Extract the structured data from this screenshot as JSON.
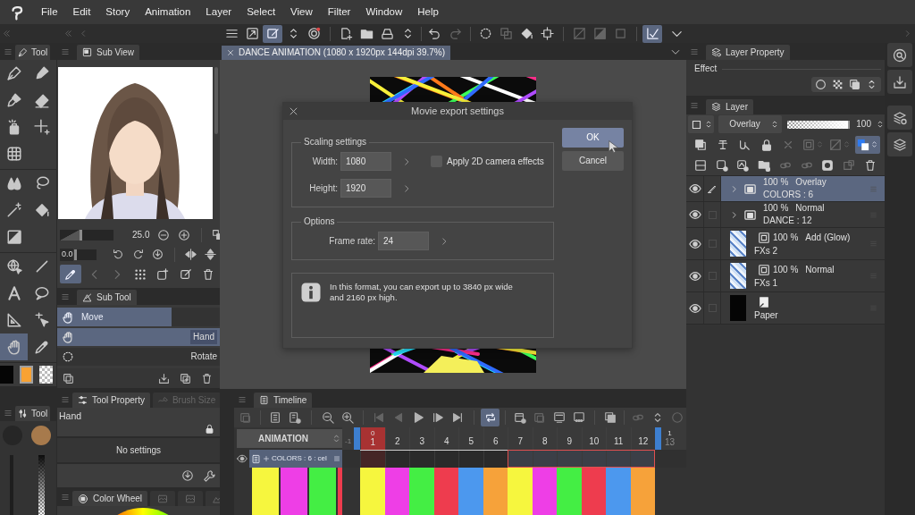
{
  "menu_bar": {
    "items": [
      "File",
      "Edit",
      "Story",
      "Animation",
      "Layer",
      "Select",
      "View",
      "Filter",
      "Window",
      "Help"
    ]
  },
  "command_bar": {
    "buttons": [
      {
        "selected": false,
        "disabled": false
      },
      {
        "selected": false,
        "disabled": false
      },
      {
        "selected": true,
        "disabled": false
      },
      {
        "selected": false,
        "disabled": false
      },
      {
        "selected": false,
        "disabled": false
      },
      {
        "selected": false,
        "disabled": false
      },
      {
        "selected": false,
        "disabled": false
      },
      {
        "selected": false,
        "disabled": false
      },
      {
        "selected": false,
        "disabled": false
      },
      {
        "selected": false,
        "disabled": false
      },
      {
        "selected": false,
        "disabled": true
      },
      {
        "selected": false,
        "disabled": false
      },
      {
        "selected": false,
        "disabled": true
      },
      {
        "selected": false,
        "disabled": false
      },
      {
        "selected": false,
        "disabled": false
      },
      {
        "selected": false,
        "disabled": true
      },
      {
        "selected": false,
        "disabled": true
      },
      {
        "selected": false,
        "disabled": true
      },
      {
        "selected": true,
        "disabled": false
      },
      {
        "selected": false,
        "disabled": false
      }
    ]
  },
  "tool_panel": {
    "tab": "Tool",
    "groups": [
      {
        "tools": [
          {
            "selected": false
          },
          {
            "selected": false
          },
          {
            "selected": false
          },
          {
            "selected": false
          },
          {
            "selected": false
          },
          {
            "selected": false
          },
          {
            "selected": false
          }
        ]
      },
      {
        "tools": [
          {
            "selected": false
          },
          {
            "selected": false
          },
          {
            "selected": false
          },
          {
            "selected": false
          },
          {
            "selected": false
          }
        ]
      },
      {
        "tools": [
          {
            "selected": false
          },
          {
            "selected": false
          },
          {
            "selected": false
          },
          {
            "selected": false
          },
          {
            "selected": false
          },
          {
            "selected": false
          },
          {
            "selected": true
          },
          {
            "selected": false
          }
        ]
      }
    ],
    "colors": [
      {
        "kind": "solid",
        "color": "#050505",
        "selected": false
      },
      {
        "kind": "solid",
        "color": "#f8a233",
        "selected": true
      },
      {
        "kind": "transparent",
        "selected": false
      }
    ]
  },
  "sub_view": {
    "tab": "Sub View",
    "zoom_slider": {
      "level": 0.42
    },
    "zoom": "25.0",
    "rotation": "0.0",
    "rotation_slider": {
      "level": 0.1
    },
    "tools": [
      {
        "selected": true,
        "disabled": false
      },
      {
        "selected": false,
        "disabled": true
      },
      {
        "selected": false,
        "disabled": true
      },
      {
        "selected": false,
        "disabled": false
      },
      {
        "selected": false,
        "disabled": false
      },
      {
        "selected": false,
        "disabled": false
      },
      {
        "selected": false,
        "disabled": false
      }
    ]
  },
  "sub_tool": {
    "tab": "Sub Tool",
    "group": "Move",
    "items": [
      {
        "label": "Hand",
        "selected": true
      },
      {
        "label": "Rotate",
        "selected": false
      }
    ]
  },
  "tool_property": {
    "tabs": [
      {
        "label": "Tool Property",
        "selected": true
      },
      {
        "label": "Brush Size",
        "selected": false
      }
    ],
    "tool_name": "Hand",
    "message": "No settings"
  },
  "color_panel": {
    "tabs": [
      {
        "label": "Color Wheel",
        "selected": true
      },
      {
        "selected": false
      },
      {
        "selected": false
      },
      {
        "selected": false
      }
    ]
  },
  "mini_tool": {
    "tab": "Tool",
    "colors": [
      {
        "color": "#262626"
      },
      {
        "color": "#a77a4c"
      }
    ]
  },
  "canvas": {
    "tab": "DANCE ANIMATION (1080 x 1920px 144dpi 39.7%)"
  },
  "dialog": {
    "title": "Movie export settings",
    "scaling": {
      "title": "Scaling settings",
      "fields": [
        {
          "label": "Width:",
          "value": "1080"
        },
        {
          "label": "Height:",
          "value": "1920"
        }
      ],
      "camera_effects": {
        "label": "Apply 2D camera effects",
        "checked": false
      }
    },
    "options": {
      "title": "Options",
      "fields": [
        {
          "label": "Frame rate:",
          "value": "24"
        }
      ]
    },
    "note": "In this format, you can export up to 3840 px wide and 2160 px high.",
    "buttons": [
      {
        "label": "OK",
        "highlighted": true
      },
      {
        "label": "Cancel",
        "highlighted": false
      }
    ]
  },
  "layer_property": {
    "tab": "Layer Property",
    "section": "Effect"
  },
  "layer_panel": {
    "tab": "Layer",
    "blend_mode": "Overlay",
    "opacity_slider": {
      "level": 1
    },
    "opacity": "100",
    "tool_rows": [
      {
        "buttons": [
          {
            "selected": false,
            "disabled": false
          },
          {
            "selected": false,
            "disabled": false
          },
          {
            "selected": false,
            "disabled": false
          },
          {
            "selected": false,
            "disabled": false
          },
          {
            "selected": false,
            "disabled": true
          },
          {
            "selected": false,
            "disabled": true
          },
          {
            "selected": false,
            "disabled": true
          },
          {
            "selected": true,
            "disabled": false
          }
        ]
      },
      {
        "buttons": [
          {
            "selected": false,
            "disabled": false
          },
          {
            "selected": false,
            "disabled": false
          },
          {
            "selected": false,
            "disabled": false
          },
          {
            "selected": false,
            "disabled": false
          },
          {
            "selected": false,
            "disabled": true
          },
          {
            "selected": false,
            "disabled": true
          },
          {
            "selected": false,
            "disabled": false
          },
          {
            "selected": false,
            "disabled": true
          },
          {
            "selected": false,
            "disabled": false
          }
        ]
      }
    ],
    "layers": [
      {
        "kind": "folder",
        "visible": true,
        "editing": true,
        "expanded": false,
        "opacity": "100 %",
        "blend": "Overlay",
        "name": "COLORS : 6",
        "selected": true
      },
      {
        "kind": "folder",
        "visible": true,
        "editing": false,
        "expanded": false,
        "opacity": "100 %",
        "blend": "Normal",
        "name": "DANCE : 12",
        "selected": false
      },
      {
        "kind": "raster",
        "visible": true,
        "editing": false,
        "opacity": "100 %",
        "blend": "Add (Glow)",
        "name": "FXs 2",
        "selected": false
      },
      {
        "kind": "raster",
        "visible": true,
        "editing": false,
        "opacity": "100 %",
        "blend": "Normal",
        "name": "FXs 1",
        "selected": false
      },
      {
        "kind": "paper",
        "visible": true,
        "editing": false,
        "name": "Paper",
        "selected": false
      }
    ]
  },
  "timeline": {
    "tab": "Timeline",
    "tools": [
      {
        "selected": false,
        "disabled": true
      },
      {
        "selected": false,
        "disabled": false
      },
      {
        "selected": false,
        "disabled": false
      },
      {
        "selected": false,
        "disabled": false
      },
      {
        "selected": false,
        "disabled": false
      },
      {
        "selected": false,
        "disabled": true
      },
      {
        "selected": false,
        "disabled": true
      },
      {
        "selected": false,
        "disabled": false
      },
      {
        "selected": false,
        "disabled": false
      },
      {
        "selected": false,
        "disabled": false
      },
      {
        "selected": true,
        "disabled": false
      },
      {
        "selected": false,
        "disabled": false
      },
      {
        "selected": false,
        "disabled": true
      },
      {
        "selected": false,
        "disabled": false
      },
      {
        "selected": false,
        "disabled": false
      },
      {
        "selected": false,
        "disabled": false
      },
      {
        "selected": false,
        "disabled": true
      },
      {
        "selected": false,
        "disabled": false
      },
      {
        "selected": false,
        "disabled": true
      }
    ],
    "track_selector": "ANIMATION",
    "ruler": {
      "before": "-1",
      "frames": [
        {
          "label": "1",
          "mark": "0",
          "selected": true
        },
        {
          "label": "2",
          "selected": false
        },
        {
          "label": "3",
          "selected": false
        },
        {
          "label": "4",
          "selected": false
        },
        {
          "label": "5",
          "selected": false
        },
        {
          "label": "6",
          "selected": false
        },
        {
          "label": "7",
          "selected": false
        },
        {
          "label": "8",
          "selected": false
        },
        {
          "label": "9",
          "selected": false
        },
        {
          "label": "10",
          "selected": false
        },
        {
          "label": "11",
          "selected": false
        },
        {
          "label": "12",
          "selected": false
        }
      ],
      "after": {
        "label": "13",
        "mark": "1"
      }
    },
    "track": {
      "name": "COLORS : 6 : cel",
      "visible": true,
      "cels": [
        {
          "selected": false
        },
        {
          "selected": true
        }
      ],
      "thumbnails": [
        {
          "color": "#f6f63e"
        },
        {
          "color": "#ee3ee6"
        },
        {
          "color": "#44ee44"
        },
        {
          "color": "#ee3c4e"
        }
      ],
      "frames": [
        {
          "color": "#f6f63e"
        },
        {
          "color": "#ee3ee6"
        },
        {
          "color": "#44ee44"
        },
        {
          "color": "#ee3c4e"
        },
        {
          "color": "#4c98ee"
        },
        {
          "color": "#f6a23a"
        },
        {
          "color": "#f6f63e"
        },
        {
          "color": "#ee3ee6"
        },
        {
          "color": "#44ee44"
        },
        {
          "color": "#ee3c4e"
        },
        {
          "color": "#4c98ee"
        },
        {
          "color": "#f6a23a"
        }
      ]
    }
  }
}
